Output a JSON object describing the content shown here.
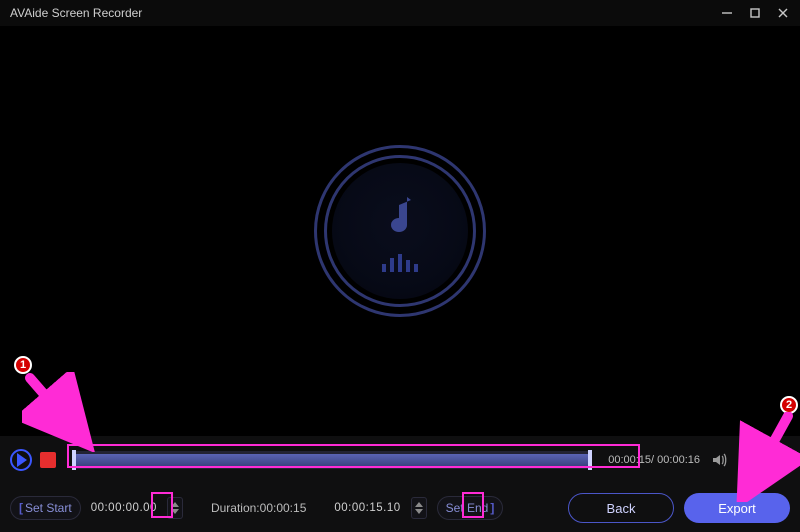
{
  "app_title": "AVAide Screen Recorder",
  "playback": {
    "current_time": "00:00:15",
    "total_time": "00:00:16",
    "time_separator": "/ "
  },
  "trim": {
    "set_start_label": "Set Start",
    "start_time": "00:00:00.00",
    "duration_prefix": "Duration:",
    "duration_value": "00:00:15",
    "end_time": "00:00:15.10",
    "set_end_label": "Set End"
  },
  "buttons": {
    "back": "Back",
    "export": "Export"
  },
  "annotations": {
    "m1": "1",
    "m2": "2"
  }
}
